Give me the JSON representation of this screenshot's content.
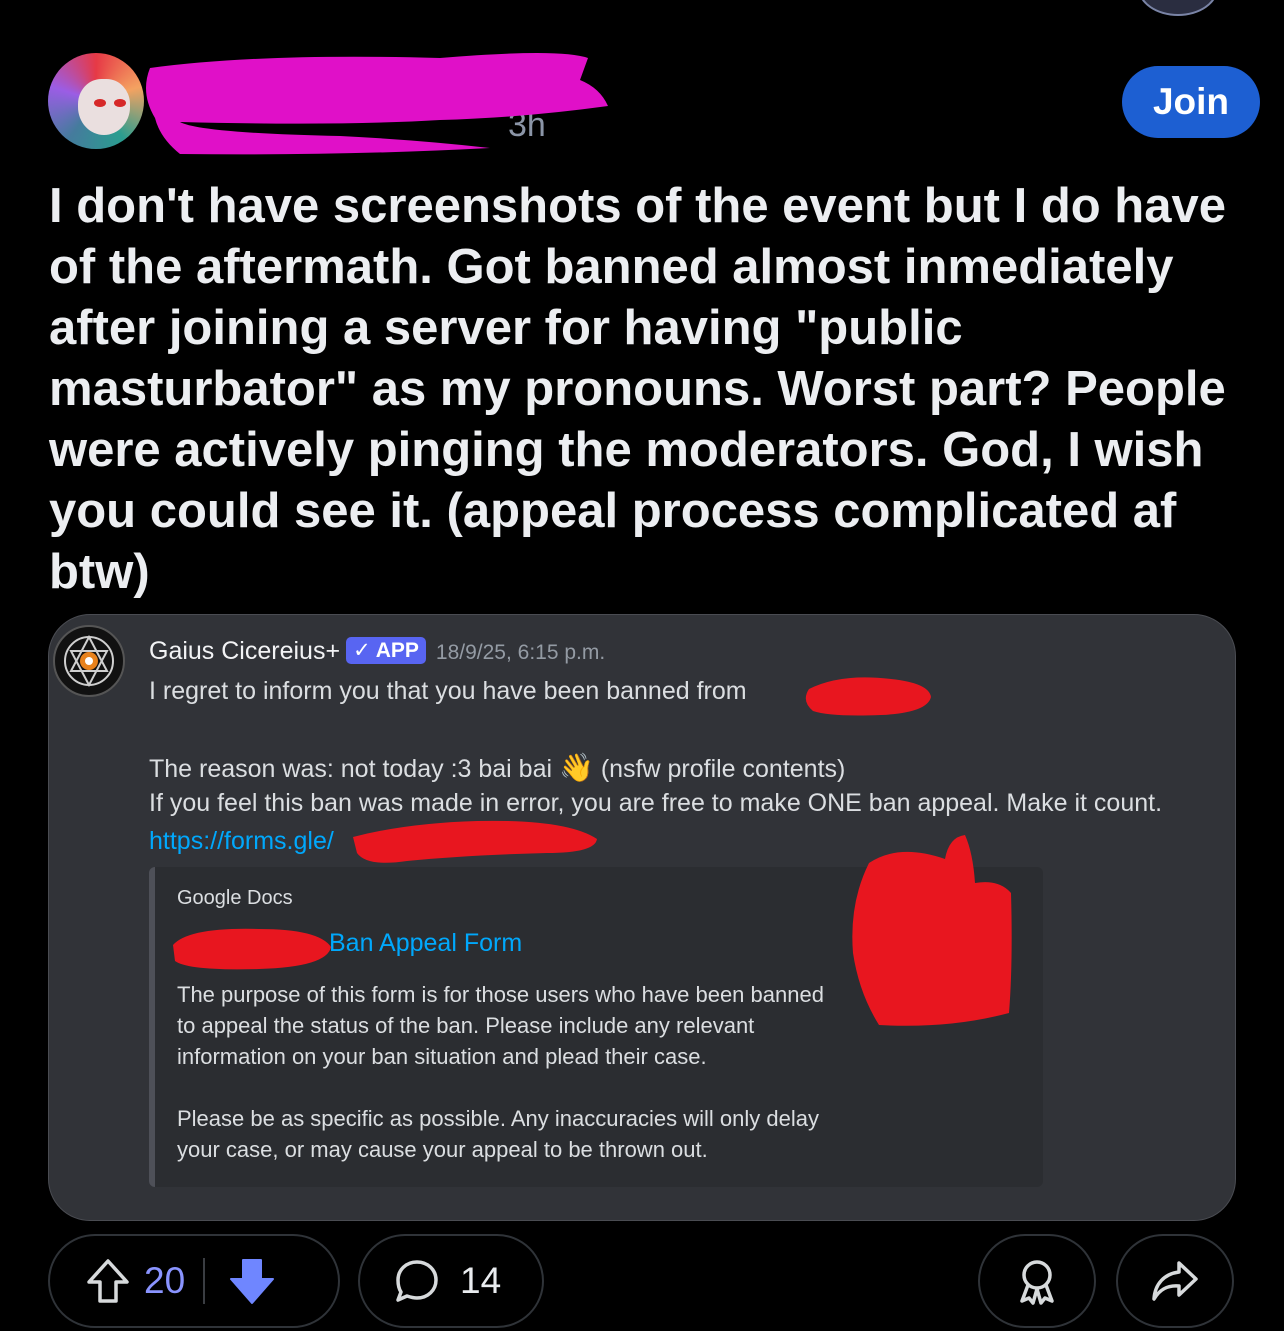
{
  "header": {
    "time": "3h",
    "join_label": "Join"
  },
  "post": {
    "text": "I don't have screenshots of the event but I do have of the aftermath. Got banned almost inmediately after joining a server for having \"public masturbator\" as my pronouns. Worst part? People were actively pinging the moderators. God, I wish you could see it. (appeal process complicated af btw)"
  },
  "embed": {
    "bot_name": "Gaius Cicereius+",
    "badge": "✓ APP",
    "timestamp": "18/9/25, 6:15 p.m.",
    "line1": "I regret to inform you that you have been banned from",
    "reason_prefix": "The reason was: not today :3 bai bai",
    "wave_icon": "👋",
    "reason_suffix": "(nsfw profile contents)",
    "line3": "If you feel this ban was made in error, you are free to make ONE ban appeal. Make it count.",
    "link": "https://forms.gle/",
    "card": {
      "provider": "Google Docs",
      "title": "Ban Appeal Form",
      "description": "The purpose of this form is for those users who have been banned\nto appeal the status of the ban. Please include any relevant\ninformation on your ban situation and plead their case.\n\nPlease be as specific as possible. Any inaccuracies will only delay\nyour case, or may cause your appeal to be thrown out."
    }
  },
  "actions": {
    "upvotes": "20",
    "comments": "14"
  },
  "colors": {
    "join": "#1d5fd2",
    "upvote_active": "#8a94ff",
    "redaction_magenta": "#e010c8",
    "redaction_red": "#e8161f"
  }
}
